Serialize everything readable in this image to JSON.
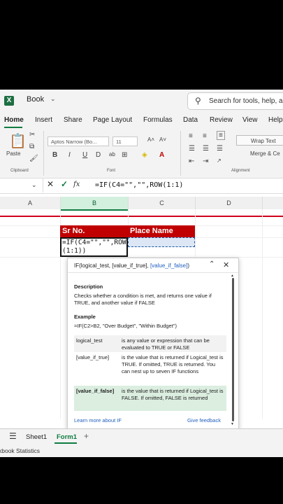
{
  "app": {
    "doc_name": "Book",
    "search_placeholder": "Search for tools, help, a"
  },
  "tabs": [
    "Home",
    "Insert",
    "Share",
    "Page Layout",
    "Formulas",
    "Data",
    "Review",
    "View",
    "Help"
  ],
  "ribbon": {
    "paste_label": "Paste",
    "clipboard_group": "Clipboard",
    "font_name": "Aptos Narrow (Bo...",
    "font_size": "11",
    "font_group": "Font",
    "wrap_text": "Wrap Text",
    "merge_center": "Merge & Ce",
    "alignment_group": "Alignment",
    "bold": "B",
    "italic": "I",
    "underline": "U",
    "strike": "D"
  },
  "formula_bar": {
    "fx": "fx",
    "formula": "=IF(C4=\"\",\"\",ROW(1:1)"
  },
  "columns": [
    "A",
    "B",
    "C",
    "D"
  ],
  "cells": {
    "b_header": "Sr No.",
    "c_header": "Place Name",
    "b_line1": "=IF(C4=\"\",\"\",ROW",
    "b_line2": "(1:1))"
  },
  "tooltip": {
    "sig_prefix": "IF(logical_test, [value_if_true], ",
    "sig_bold": "[value_if_false]",
    "sig_suffix": ")",
    "description_heading": "Description",
    "description": "Checks whether a condition is met, and returns one value if TRUE, and another value if FALSE",
    "example_heading": "Example",
    "example": "=IF(C2>B2, \"Over Budget\", \"Within Budget\")",
    "params": [
      {
        "name": "logical_test",
        "desc": "is any value or expression that can be evaluated to TRUE or FALSE"
      },
      {
        "name": "[value_if_true]",
        "desc": "is the value that is returned if Logical_test is TRUE. If omitted, TRUE is returned. You can nest up to seven IF functions"
      },
      {
        "name": "[value_if_false]",
        "desc": "is the value that is returned if Logical_test is FALSE. If omitted, FALSE is returned"
      }
    ],
    "learn_more": "Learn more about IF",
    "give_feedback": "Give feedback"
  },
  "sheets": [
    "Sheet1",
    "Form1"
  ],
  "status": "kbook Statistics"
}
